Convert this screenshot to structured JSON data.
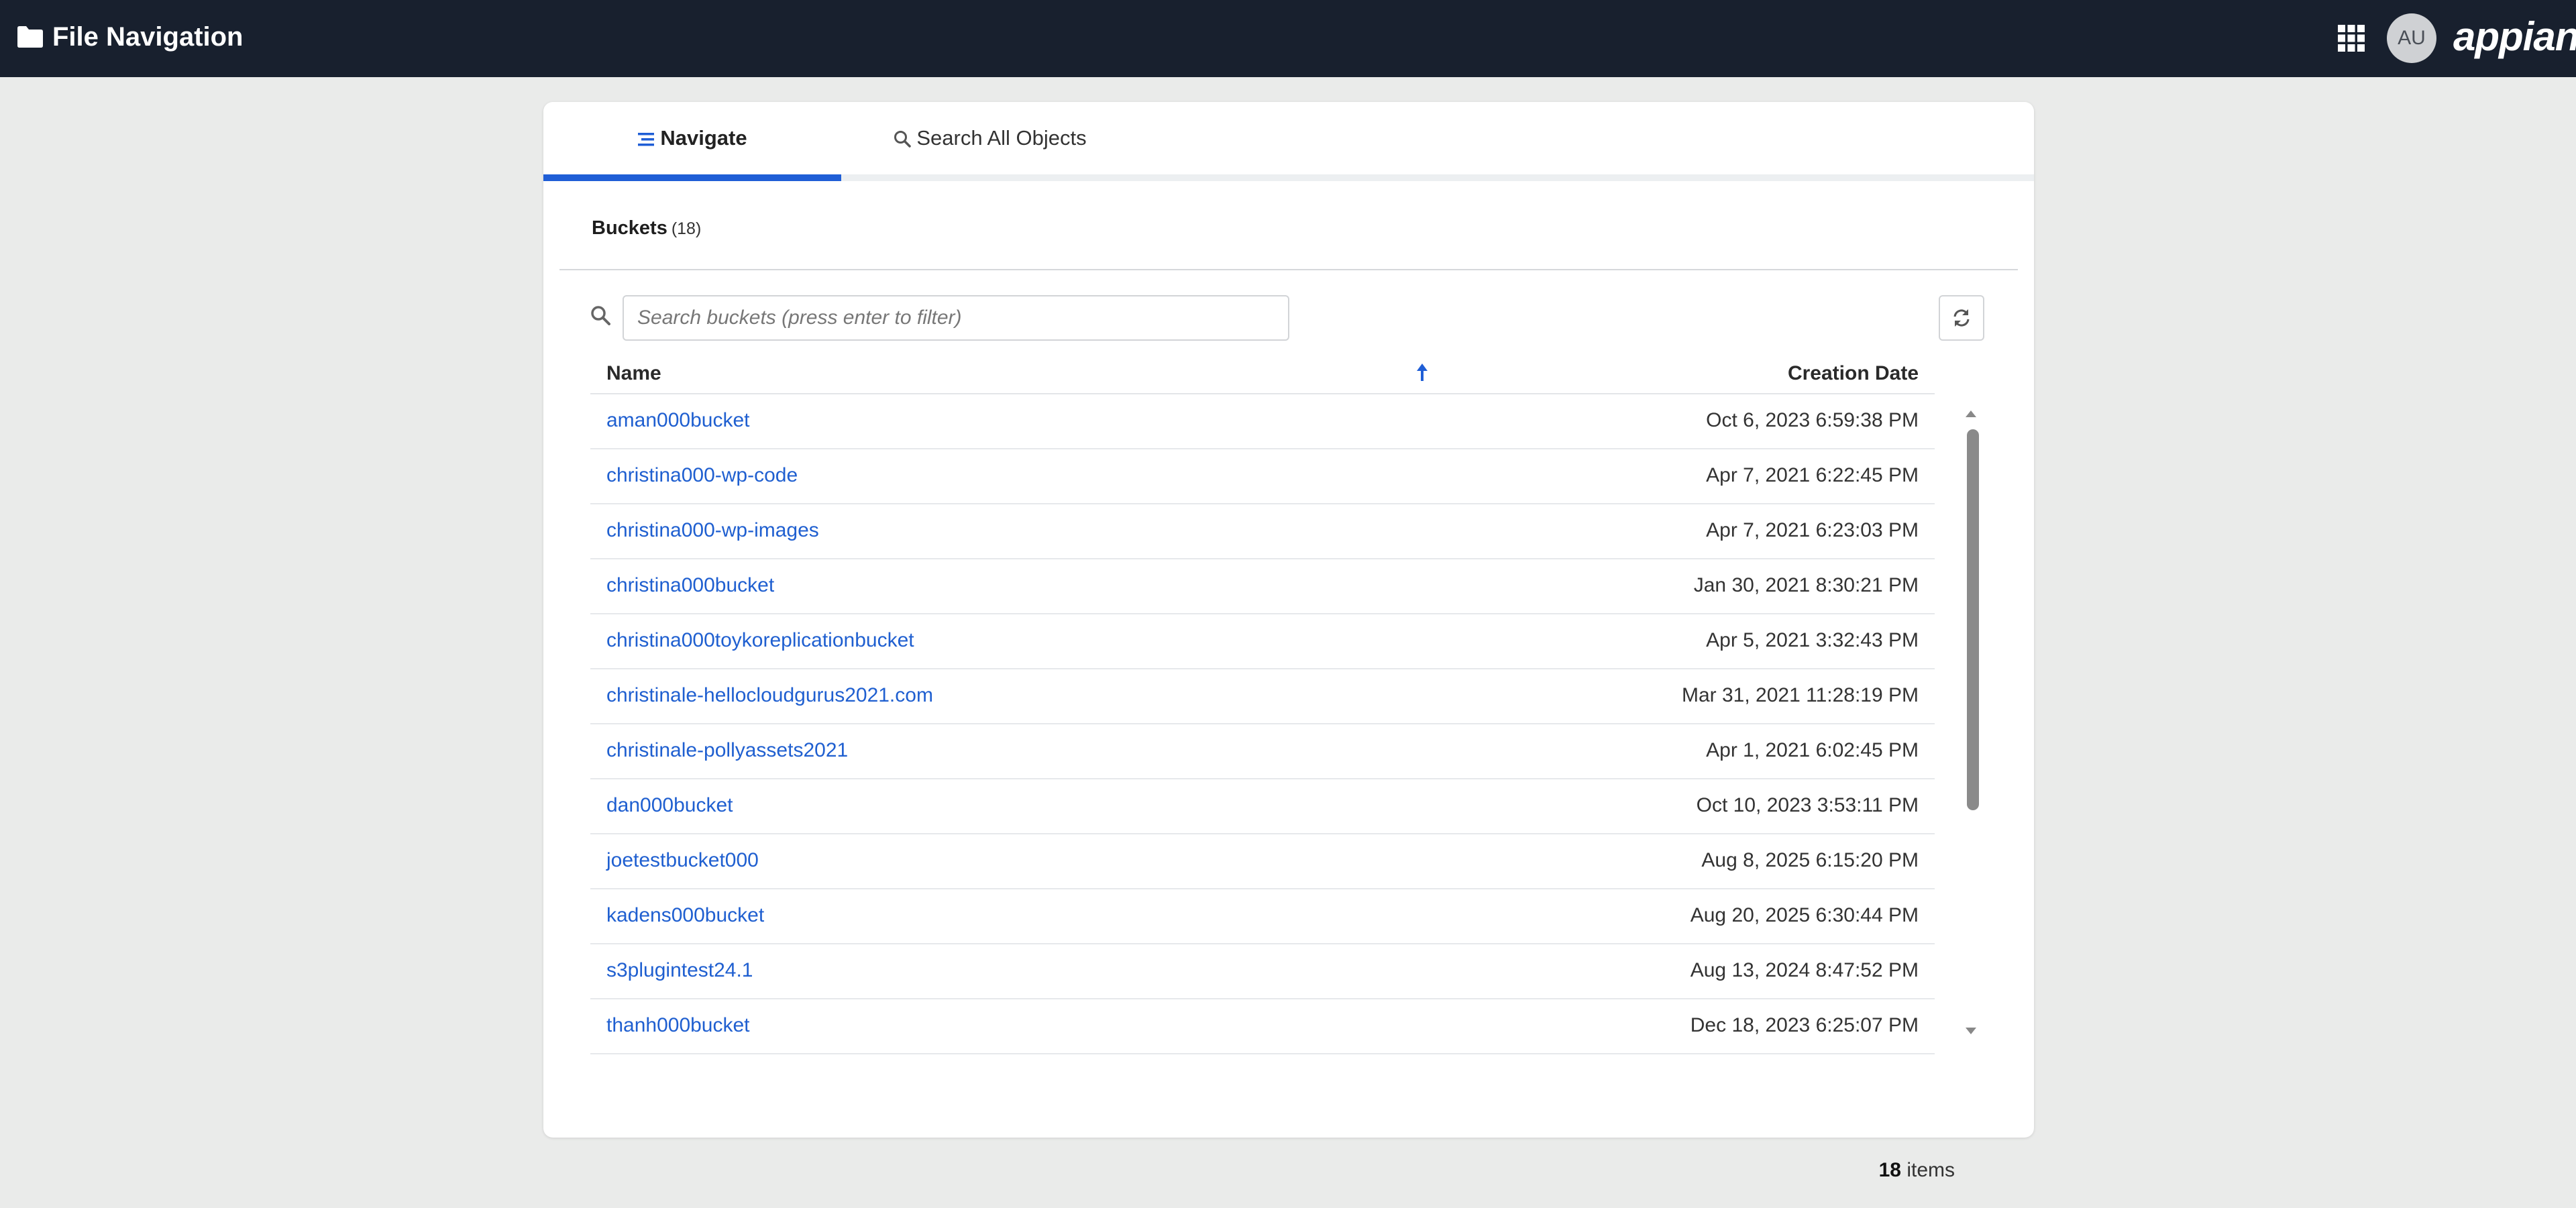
{
  "header": {
    "title": "File Navigation",
    "avatar_initials": "AU",
    "logo_text": "appian",
    "icons": [
      "folder-icon",
      "app-grid-icon"
    ]
  },
  "tabs": [
    {
      "label": "Navigate",
      "icon": "list-icon",
      "selected": true
    },
    {
      "label": "Search All Objects",
      "icon": "search-icon",
      "selected": false
    }
  ],
  "buckets": {
    "heading": "Buckets",
    "count": "(18)",
    "search_placeholder": "Search buckets (press enter to filter)",
    "columns": {
      "name": "Name",
      "date": "Creation Date"
    },
    "sort": "ascending",
    "rows": [
      {
        "name": "aman000bucket",
        "date": "Oct 6, 2023 6:59:38 PM"
      },
      {
        "name": "christina000-wp-code",
        "date": "Apr 7, 2021 6:22:45 PM"
      },
      {
        "name": "christina000-wp-images",
        "date": "Apr 7, 2021 6:23:03 PM"
      },
      {
        "name": "christina000bucket",
        "date": "Jan 30, 2021 8:30:21 PM"
      },
      {
        "name": "christina000toykoreplicationbucket",
        "date": "Apr 5, 2021 3:32:43 PM"
      },
      {
        "name": "christinale-hellocloudgurus2021.com",
        "date": "Mar 31, 2021 11:28:19 PM"
      },
      {
        "name": "christinale-pollyassets2021",
        "date": "Apr 1, 2021 6:02:45 PM"
      },
      {
        "name": "dan000bucket",
        "date": "Oct 10, 2023 3:53:11 PM"
      },
      {
        "name": "joetestbucket000",
        "date": "Aug 8, 2025 6:15:20 PM"
      },
      {
        "name": "kadens000bucket",
        "date": "Aug 20, 2025 6:30:44 PM"
      },
      {
        "name": "s3plugintest24.1",
        "date": "Aug 13, 2024 8:47:52 PM"
      },
      {
        "name": "thanh000bucket",
        "date": "Dec 18, 2023 6:25:07 PM"
      }
    ],
    "total_count": "18",
    "total_suffix": "items"
  },
  "colors": {
    "topbar": "#18202e",
    "accent": "#1f5ed6",
    "link": "#1f5fd0",
    "background": "#eaebea"
  }
}
